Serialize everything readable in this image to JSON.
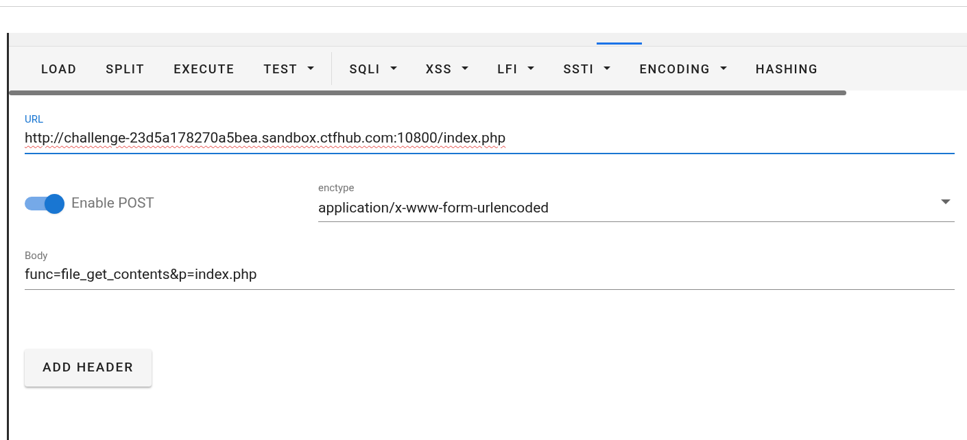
{
  "toolbar": [
    {
      "label": "LOAD",
      "kind": "button"
    },
    {
      "label": "SPLIT",
      "kind": "button"
    },
    {
      "label": "EXECUTE",
      "kind": "button"
    },
    {
      "label": "TEST",
      "kind": "dropdown"
    },
    {
      "label": "SQLI",
      "kind": "dropdown"
    },
    {
      "label": "XSS",
      "kind": "dropdown"
    },
    {
      "label": "LFI",
      "kind": "dropdown"
    },
    {
      "label": "SSTI",
      "kind": "dropdown"
    },
    {
      "label": "ENCODING",
      "kind": "dropdown"
    },
    {
      "label": "HASHING",
      "kind": "button"
    }
  ],
  "url": {
    "label": "URL",
    "value": "http://challenge-23d5a178270a5bea.sandbox.ctfhub.com:10800/index.php"
  },
  "post_toggle": {
    "label": "Enable POST",
    "on": true
  },
  "enctype": {
    "label": "enctype",
    "value": "application/x-www-form-urlencoded"
  },
  "body": {
    "label": "Body",
    "value": "func=file_get_contents&p=index.php"
  },
  "add_header_button": "ADD HEADER"
}
